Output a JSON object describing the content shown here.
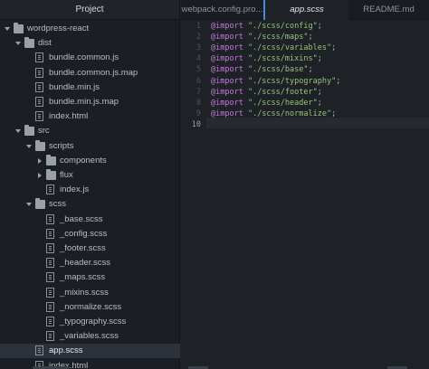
{
  "sidebar": {
    "title": "Project",
    "tree": [
      {
        "label": "wordpress-react",
        "type": "folder",
        "depth": 0,
        "expanded": true,
        "icon": "folder-icon"
      },
      {
        "label": "dist",
        "type": "folder",
        "depth": 1,
        "expanded": true,
        "icon": "folder-icon"
      },
      {
        "label": "bundle.common.js",
        "type": "file",
        "depth": 2,
        "icon": "file-icon"
      },
      {
        "label": "bundle.common.js.map",
        "type": "file",
        "depth": 2,
        "icon": "file-icon"
      },
      {
        "label": "bundle.min.js",
        "type": "file",
        "depth": 2,
        "icon": "file-icon"
      },
      {
        "label": "bundle.min.js.map",
        "type": "file",
        "depth": 2,
        "icon": "file-icon"
      },
      {
        "label": "index.html",
        "type": "file",
        "depth": 2,
        "icon": "file-icon"
      },
      {
        "label": "src",
        "type": "folder",
        "depth": 1,
        "expanded": true,
        "icon": "folder-icon"
      },
      {
        "label": "scripts",
        "type": "folder",
        "depth": 2,
        "expanded": true,
        "icon": "folder-icon"
      },
      {
        "label": "components",
        "type": "folder",
        "depth": 3,
        "expanded": false,
        "icon": "folder-icon"
      },
      {
        "label": "flux",
        "type": "folder",
        "depth": 3,
        "expanded": false,
        "icon": "folder-icon"
      },
      {
        "label": "index.js",
        "type": "file",
        "depth": 3,
        "icon": "file-icon"
      },
      {
        "label": "scss",
        "type": "folder",
        "depth": 2,
        "expanded": true,
        "icon": "folder-icon"
      },
      {
        "label": "_base.scss",
        "type": "file",
        "depth": 3,
        "icon": "file-icon"
      },
      {
        "label": "_config.scss",
        "type": "file",
        "depth": 3,
        "icon": "file-icon"
      },
      {
        "label": "_footer.scss",
        "type": "file",
        "depth": 3,
        "icon": "file-icon"
      },
      {
        "label": "_header.scss",
        "type": "file",
        "depth": 3,
        "icon": "file-icon"
      },
      {
        "label": "_maps.scss",
        "type": "file",
        "depth": 3,
        "icon": "file-icon"
      },
      {
        "label": "_mixins.scss",
        "type": "file",
        "depth": 3,
        "icon": "file-icon"
      },
      {
        "label": "_normalize.scss",
        "type": "file",
        "depth": 3,
        "icon": "file-icon"
      },
      {
        "label": "_typography.scss",
        "type": "file",
        "depth": 3,
        "icon": "file-icon"
      },
      {
        "label": "_variables.scss",
        "type": "file",
        "depth": 3,
        "icon": "file-icon"
      },
      {
        "label": "app.scss",
        "type": "file",
        "depth": 2,
        "icon": "file-icon",
        "selected": true
      },
      {
        "label": "index.html",
        "type": "file",
        "depth": 2,
        "icon": "file-icon"
      }
    ]
  },
  "tabs": [
    {
      "label": "webpack.config.pro...",
      "active": false
    },
    {
      "label": "app.scss",
      "active": true
    },
    {
      "label": "README.md",
      "active": false
    }
  ],
  "editor": {
    "current_line": 10,
    "lines": [
      {
        "num": "1",
        "keyword": "@import",
        "string": "\"./scss/config\"",
        "end": ";"
      },
      {
        "num": "2",
        "keyword": "@import",
        "string": "\"./scss/maps\"",
        "end": ";"
      },
      {
        "num": "3",
        "keyword": "@import",
        "string": "\"./scss/variables\"",
        "end": ";"
      },
      {
        "num": "4",
        "keyword": "@import",
        "string": "\"./scss/mixins\"",
        "end": ";"
      },
      {
        "num": "5",
        "keyword": "@import",
        "string": "\"./scss/base\"",
        "end": ";"
      },
      {
        "num": "6",
        "keyword": "@import",
        "string": "\"./scss/typography\"",
        "end": ";"
      },
      {
        "num": "7",
        "keyword": "@import",
        "string": "\"./scss/footer\"",
        "end": ";"
      },
      {
        "num": "8",
        "keyword": "@import",
        "string": "\"./scss/header\"",
        "end": ";"
      },
      {
        "num": "9",
        "keyword": "@import",
        "string": "\"./scss/normalize\"",
        "end": ";"
      },
      {
        "num": "10",
        "keyword": "",
        "string": "",
        "end": ""
      }
    ]
  },
  "colors": {
    "keyword": "#c678dd",
    "string": "#98c379",
    "active_tab_accent": "#4a8bd6",
    "background": "#1e2227"
  }
}
